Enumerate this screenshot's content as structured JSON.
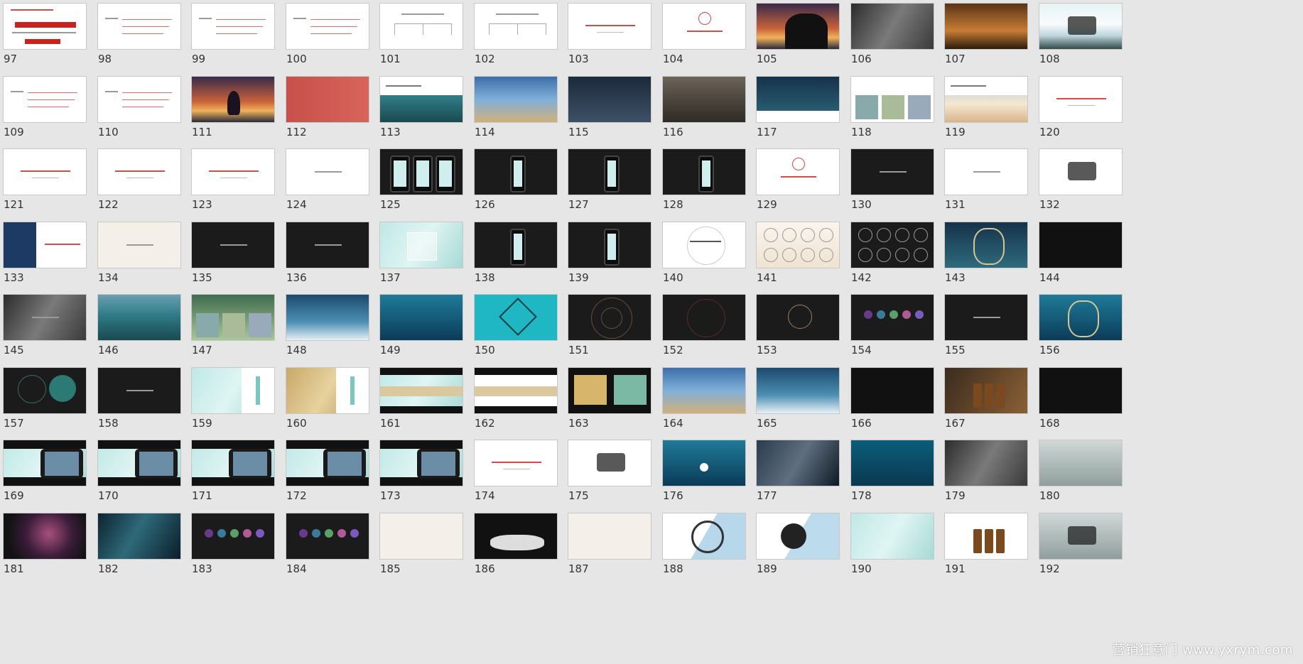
{
  "window": {
    "watermark": "营销狂意门 www.yxrym.com"
  },
  "slides": [
    {
      "n": "97",
      "style": "t-white",
      "deco": "redtitle"
    },
    {
      "n": "98",
      "style": "t-white",
      "deco": "textlines"
    },
    {
      "n": "99",
      "style": "t-white",
      "deco": "textlines"
    },
    {
      "n": "100",
      "style": "t-white",
      "deco": "textlines"
    },
    {
      "n": "101",
      "style": "t-white",
      "deco": "tree"
    },
    {
      "n": "102",
      "style": "t-white",
      "deco": "tree"
    },
    {
      "n": "103",
      "style": "t-white",
      "deco": "centertext"
    },
    {
      "n": "104",
      "style": "t-white",
      "deco": "redring"
    },
    {
      "n": "105",
      "style": "t-sunset",
      "deco": "horse"
    },
    {
      "n": "106",
      "style": "t-rock",
      "deco": "none"
    },
    {
      "n": "107",
      "style": "t-library",
      "deco": "none"
    },
    {
      "n": "108",
      "style": "t-lake",
      "deco": "calligraphy"
    },
    {
      "n": "109",
      "style": "t-white",
      "deco": "textlines"
    },
    {
      "n": "110",
      "style": "t-white",
      "deco": "textlines"
    },
    {
      "n": "111",
      "style": "t-sunset",
      "deco": "meditate"
    },
    {
      "n": "112",
      "style": "t-red",
      "deco": "none"
    },
    {
      "n": "113",
      "style": "t-forest",
      "deco": "topwhite"
    },
    {
      "n": "114",
      "style": "t-sea",
      "deco": "none"
    },
    {
      "n": "115",
      "style": "t-stormy",
      "deco": "none"
    },
    {
      "n": "116",
      "style": "t-bedroom",
      "deco": "none"
    },
    {
      "n": "117",
      "style": "t-deep",
      "deco": "bottomwhite"
    },
    {
      "n": "118",
      "style": "t-white",
      "deco": "photos"
    },
    {
      "n": "119",
      "style": "t-yogabeach",
      "deco": "topwhite"
    },
    {
      "n": "120",
      "style": "t-white",
      "deco": "centertext"
    },
    {
      "n": "121",
      "style": "t-white",
      "deco": "centertext"
    },
    {
      "n": "122",
      "style": "t-white",
      "deco": "centertext"
    },
    {
      "n": "123",
      "style": "t-white",
      "deco": "centertext"
    },
    {
      "n": "124",
      "style": "t-white",
      "deco": "greytext"
    },
    {
      "n": "125",
      "style": "t-dark",
      "deco": "phones3"
    },
    {
      "n": "126",
      "style": "t-dark",
      "deco": "phone"
    },
    {
      "n": "127",
      "style": "t-dark",
      "deco": "phone"
    },
    {
      "n": "128",
      "style": "t-dark",
      "deco": "phone"
    },
    {
      "n": "129",
      "style": "t-white",
      "deco": "redring"
    },
    {
      "n": "130",
      "style": "t-dark",
      "deco": "greytext"
    },
    {
      "n": "131",
      "style": "t-white",
      "deco": "greytext"
    },
    {
      "n": "132",
      "style": "t-white",
      "deco": "calligraphy"
    },
    {
      "n": "133",
      "style": "t-white",
      "deco": "bluebox"
    },
    {
      "n": "134",
      "style": "t-cream",
      "deco": "greytext"
    },
    {
      "n": "135",
      "style": "t-dark",
      "deco": "greytext"
    },
    {
      "n": "136",
      "style": "t-dark",
      "deco": "greytext"
    },
    {
      "n": "137",
      "style": "t-teal",
      "deco": "square"
    },
    {
      "n": "138",
      "style": "t-dark",
      "deco": "phone"
    },
    {
      "n": "139",
      "style": "t-dark",
      "deco": "phone"
    },
    {
      "n": "140",
      "style": "t-white",
      "deco": "circlefine"
    },
    {
      "n": "141",
      "style": "t-warm",
      "deco": "geo"
    },
    {
      "n": "142",
      "style": "t-dark",
      "deco": "geo"
    },
    {
      "n": "143",
      "style": "t-deep",
      "deco": "mandala"
    },
    {
      "n": "144",
      "style": "t-black",
      "deco": "none"
    },
    {
      "n": "145",
      "style": "t-rock",
      "deco": "greytext"
    },
    {
      "n": "146",
      "style": "t-forest",
      "deco": "none"
    },
    {
      "n": "147",
      "style": "t-green",
      "deco": "photos"
    },
    {
      "n": "148",
      "style": "t-bluewave",
      "deco": "none"
    },
    {
      "n": "149",
      "style": "t-tealwave",
      "deco": "none"
    },
    {
      "n": "150",
      "style": "t-cyan",
      "deco": "geo1"
    },
    {
      "n": "151",
      "style": "t-dark",
      "deco": "flower"
    },
    {
      "n": "152",
      "style": "t-dark",
      "deco": "flowerred"
    },
    {
      "n": "153",
      "style": "t-dark",
      "deco": "flowersmall"
    },
    {
      "n": "154",
      "style": "t-dark",
      "deco": "dots5"
    },
    {
      "n": "155",
      "style": "t-dark",
      "deco": "greytext"
    },
    {
      "n": "156",
      "style": "t-tealwave",
      "deco": "mandala"
    },
    {
      "n": "157",
      "style": "t-dark",
      "deco": "twocircles"
    },
    {
      "n": "158",
      "style": "t-dark",
      "deco": "greytext"
    },
    {
      "n": "159",
      "style": "t-teal",
      "deco": "rightwhite"
    },
    {
      "n": "160",
      "style": "t-gold",
      "deco": "rightwhite"
    },
    {
      "n": "161",
      "style": "t-teal",
      "deco": "bands"
    },
    {
      "n": "162",
      "style": "t-white",
      "deco": "bands"
    },
    {
      "n": "163",
      "style": "t-black",
      "deco": "cards2"
    },
    {
      "n": "164",
      "style": "t-sea",
      "deco": "none"
    },
    {
      "n": "165",
      "style": "t-bluewave",
      "deco": "none"
    },
    {
      "n": "166",
      "style": "t-black",
      "deco": "none"
    },
    {
      "n": "167",
      "style": "t-brown",
      "deco": "bottles"
    },
    {
      "n": "168",
      "style": "t-black",
      "deco": "none"
    },
    {
      "n": "169",
      "style": "t-teal",
      "deco": "phonebar"
    },
    {
      "n": "170",
      "style": "t-teal",
      "deco": "phonebar"
    },
    {
      "n": "171",
      "style": "t-teal",
      "deco": "phonebar"
    },
    {
      "n": "172",
      "style": "t-teal",
      "deco": "phonebar"
    },
    {
      "n": "173",
      "style": "t-teal",
      "deco": "phonebar"
    },
    {
      "n": "174",
      "style": "t-white",
      "deco": "centertext"
    },
    {
      "n": "175",
      "style": "t-white",
      "deco": "calligraphy"
    },
    {
      "n": "176",
      "style": "t-tealwave",
      "deco": "sun"
    },
    {
      "n": "177",
      "style": "t-smoke",
      "deco": "none"
    },
    {
      "n": "178",
      "style": "t-ocean",
      "deco": "none"
    },
    {
      "n": "179",
      "style": "t-rock",
      "deco": "none"
    },
    {
      "n": "180",
      "style": "t-mist",
      "deco": "none"
    },
    {
      "n": "181",
      "style": "t-pinkdark",
      "deco": "none"
    },
    {
      "n": "182",
      "style": "t-fabric",
      "deco": "none"
    },
    {
      "n": "183",
      "style": "t-dark",
      "deco": "dots5"
    },
    {
      "n": "184",
      "style": "t-dark",
      "deco": "dots5"
    },
    {
      "n": "185",
      "style": "t-cream",
      "deco": "none"
    },
    {
      "n": "186",
      "style": "t-black",
      "deco": "table"
    },
    {
      "n": "187",
      "style": "t-cream",
      "deco": "none"
    },
    {
      "n": "188",
      "style": "t-white",
      "deco": "chair"
    },
    {
      "n": "189",
      "style": "t-white",
      "deco": "record"
    },
    {
      "n": "190",
      "style": "t-teal",
      "deco": "none"
    },
    {
      "n": "191",
      "style": "t-white",
      "deco": "bottles"
    },
    {
      "n": "192",
      "style": "t-mist",
      "deco": "calligraphy"
    }
  ]
}
